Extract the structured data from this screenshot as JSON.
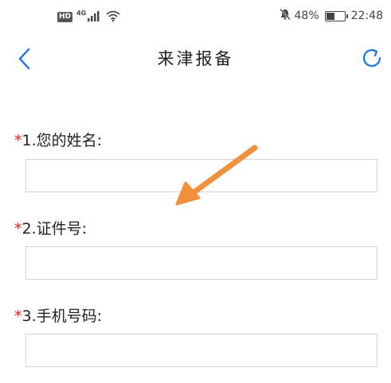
{
  "status_bar": {
    "hd_badge": "HD",
    "network_type": "4G",
    "battery_percent": "48%",
    "battery_level": 0.48,
    "time": "22:48",
    "icons": [
      "signal-icon",
      "wifi-icon",
      "mute-bell-icon",
      "battery-icon"
    ]
  },
  "nav": {
    "title": "来津报备",
    "back_icon": "chevron-left-icon",
    "refresh_icon": "refresh-icon",
    "accent_color": "#1a73e8"
  },
  "form": {
    "required_mark": "*",
    "fields": [
      {
        "label": "1.您的姓名:",
        "value": "",
        "placeholder": ""
      },
      {
        "label": "2.证件号:",
        "value": "",
        "placeholder": ""
      },
      {
        "label": "3.手机号码:",
        "value": "",
        "placeholder": ""
      }
    ]
  },
  "annotation": {
    "icon": "arrow-annotation-icon",
    "color": "#f0903a"
  }
}
